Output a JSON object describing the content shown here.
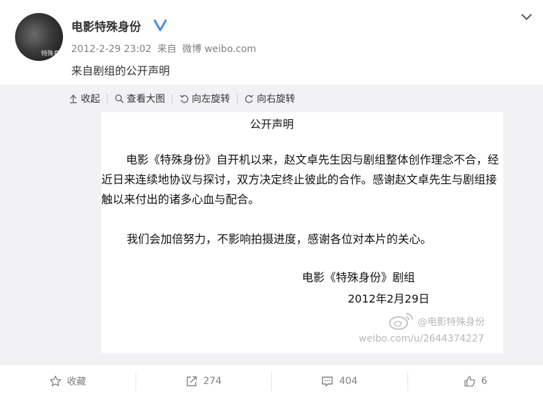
{
  "post": {
    "username": "电影特殊身份",
    "timestamp": "2012-2-29 23:02",
    "source_prefix": "来自",
    "source": "微博 weibo.com",
    "text": "来自剧组的公开声明",
    "avatar_overlay": "特殊身"
  },
  "toolbar": {
    "collapse": "收起",
    "view_large": "查看大图",
    "rotate_left": "向左旋转",
    "rotate_right": "向右旋转"
  },
  "statement": {
    "title": "公开声明",
    "para1": "电影《特殊身份》自开机以来，赵文卓先生因与剧组整体创作理念不合，经近日来连续地协议与探讨，双方决定终止彼此的合作。感谢赵文卓先生与剧组接触以来付出的诸多心血与配合。",
    "para2": "我们会加倍努力，不影响拍摄进度，感谢各位对本片的关心。",
    "signature": "电影《特殊身份》剧组",
    "date": "2012年2月29日",
    "watermark_user": "@电影特殊身份",
    "watermark_url": "weibo.com/u/2644374227"
  },
  "actions": {
    "favorite": "收藏",
    "repost_count": "274",
    "comment_count": "404",
    "like_count": "6"
  },
  "colors": {
    "verified": "#4a90e2",
    "muted_text": "#808080",
    "media_bg": "#f2f2f5"
  },
  "icons": [
    "avatar",
    "verified-icon",
    "chevron-down-icon",
    "collapse-icon",
    "magnifier-icon",
    "rotate-left-icon",
    "rotate-right-icon",
    "weibo-logo-icon",
    "star-icon",
    "repost-icon",
    "comment-icon",
    "like-icon"
  ]
}
